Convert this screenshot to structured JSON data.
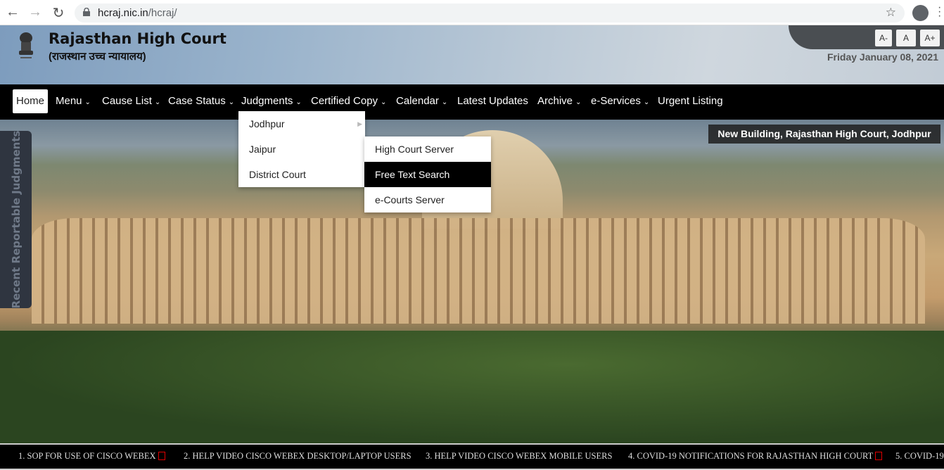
{
  "browser": {
    "url_host": "hcraj.nic.in",
    "url_path": "/hcraj/"
  },
  "header": {
    "title": "Rajasthan High Court",
    "subtitle": "(राजस्थान उच्च न्यायालय)",
    "date": "Friday January 08, 2021",
    "font_buttons": [
      "A-",
      "A",
      "A+"
    ]
  },
  "nav": {
    "items": [
      {
        "label": "Home"
      },
      {
        "label": "Menu"
      },
      {
        "label": "Cause List"
      },
      {
        "label": "Case Status"
      },
      {
        "label": "Judgments"
      },
      {
        "label": "Certified Copy"
      },
      {
        "label": "Calendar"
      },
      {
        "label": "Latest Updates"
      },
      {
        "label": "Archive"
      },
      {
        "label": "e-Services"
      },
      {
        "label": "Urgent Listing"
      }
    ]
  },
  "judgments_menu": {
    "items": [
      "Jodhpur",
      "Jaipur",
      "District Court"
    ]
  },
  "jodhpur_submenu": {
    "items": [
      "High Court Server",
      "Free Text Search",
      "e-Courts Server"
    ],
    "active": "Free Text Search"
  },
  "hero": {
    "caption": "New Building, Rajasthan High Court, Jodhpur"
  },
  "sidebar": {
    "tab_label": "Recent Reportable Judgments"
  },
  "ticker": {
    "items": [
      "1. SOP FOR USE OF CISCO WEBEX",
      "2. HELP VIDEO CISCO WEBEX DESKTOP/LAPTOP USERS",
      "3. HELP VIDEO CISCO WEBEX MOBILE USERS",
      "4. COVID-19 NOTIFICATIONS FOR RAJASTHAN HIGH COURT",
      "5. COVID-19"
    ]
  },
  "colors": {
    "nav_bg": "#000000",
    "sidebar_tab": "#2f3540",
    "pdf_icon": "#dd0000"
  }
}
